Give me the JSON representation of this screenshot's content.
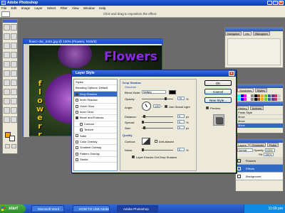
{
  "app": {
    "title": "Adobe Photoshop"
  },
  "menu": [
    "File",
    "Edit",
    "Image",
    "Layer",
    "Select",
    "Filter",
    "View",
    "Window",
    "Help"
  ],
  "options_bar": {
    "hint": "Click and drag to reposition the effect."
  },
  "document": {
    "title": "flowrz-dsc_0401.jpg @ 100% (Flowers, RGB/8)",
    "text_horizontal": "Flowers",
    "text_vertical": "flowerr"
  },
  "palettes": {
    "top_tabs": [
      "Navigator",
      "Info",
      "Histogram"
    ],
    "swatch_tabs": [
      "Color",
      "Swatches",
      "Styles"
    ],
    "history_tabs": [
      "History",
      "Actions"
    ],
    "history_items": [
      "Paste Style",
      "Move",
      "Move",
      "Move"
    ],
    "layers_tabs": [
      "Layers",
      "Channels",
      "Paths"
    ],
    "layers_mode": "Normal",
    "layers_opacity_label": "Opacity:",
    "layers_opacity": "100%",
    "layers_fill_label": "Fill:",
    "layers_fill": "100%",
    "layers": [
      "Flowers",
      "Effects",
      "Background"
    ]
  },
  "dialog": {
    "title": "Layer Style",
    "style_list": [
      {
        "label": "Styles",
        "check": false,
        "has_box": false,
        "selected": false,
        "sub": false
      },
      {
        "label": "Blending Options: Default",
        "check": false,
        "has_box": false,
        "selected": false,
        "sub": false
      },
      {
        "label": "Drop Shadow",
        "check": true,
        "has_box": true,
        "selected": true,
        "sub": false
      },
      {
        "label": "Inner Shadow",
        "check": false,
        "has_box": true,
        "selected": false,
        "sub": false
      },
      {
        "label": "Outer Glow",
        "check": false,
        "has_box": true,
        "selected": false,
        "sub": false
      },
      {
        "label": "Inner Glow",
        "check": false,
        "has_box": true,
        "selected": false,
        "sub": false
      },
      {
        "label": "Bevel and Emboss",
        "check": true,
        "has_box": true,
        "selected": false,
        "sub": false
      },
      {
        "label": "Contour",
        "check": false,
        "has_box": true,
        "selected": false,
        "sub": true
      },
      {
        "label": "Texture",
        "check": false,
        "has_box": true,
        "selected": false,
        "sub": true
      },
      {
        "label": "Satin",
        "check": false,
        "has_box": true,
        "selected": false,
        "sub": false
      },
      {
        "label": "Color Overlay",
        "check": false,
        "has_box": true,
        "selected": false,
        "sub": false
      },
      {
        "label": "Gradient Overlay",
        "check": false,
        "has_box": true,
        "selected": false,
        "sub": false
      },
      {
        "label": "Pattern Overlay",
        "check": false,
        "has_box": true,
        "selected": false,
        "sub": false
      },
      {
        "label": "Stroke",
        "check": false,
        "has_box": true,
        "selected": false,
        "sub": false
      }
    ],
    "section_title": "Drop Shadow",
    "structure_label": "Structure",
    "blend_mode_label": "Blend Mode:",
    "blend_mode": "Multiply",
    "opacity_label": "Opacity:",
    "opacity": "75",
    "angle_label": "Angle:",
    "angle": "120",
    "global_light_label": "Use Global Light",
    "distance_label": "Distance:",
    "distance": "5",
    "spread_label": "Spread:",
    "spread": "0",
    "size_label": "Size:",
    "size": "5",
    "quality_label": "Quality",
    "contour_label": "Contour:",
    "antialiased_label": "Anti-aliased",
    "noise_label": "Noise:",
    "noise": "0",
    "knockout_label": "Layer Knocks Out Drop Shadow",
    "ok": "OK",
    "cancel": "Cancel",
    "new_style": "New Style...",
    "preview": "Preview",
    "percent": "%",
    "px": "px",
    "deg": "°"
  },
  "taskbar": {
    "start": "start",
    "tasks": [
      "Microsoft Word - ...",
      "HOW TO USE Adobe...",
      "Adobe Photoshop"
    ],
    "clock": "11:09 pm"
  }
}
